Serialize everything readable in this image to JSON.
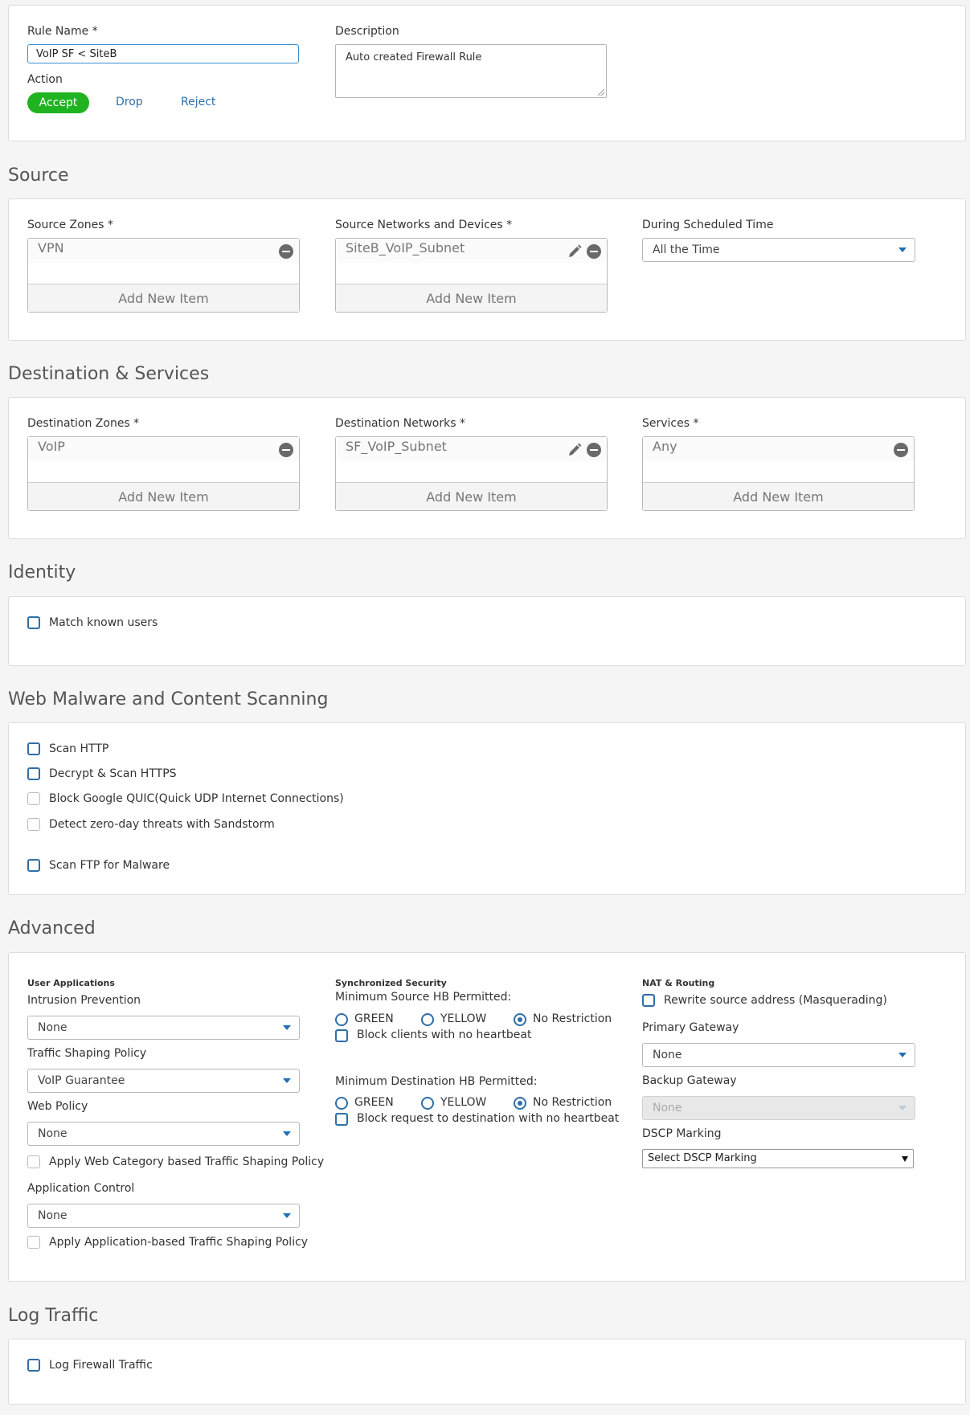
{
  "rule": {
    "name_label": "Rule Name *",
    "name_value": "VoIP SF < SiteB",
    "description_label": "Description",
    "description_value": "Auto created Firewall Rule",
    "action_label": "Action",
    "actions": [
      "Accept",
      "Drop",
      "Reject"
    ],
    "selected_action": "Accept"
  },
  "source": {
    "heading": "Source",
    "zones_label": "Source Zones *",
    "zones_item": "VPN",
    "networks_label": "Source Networks and Devices *",
    "networks_item": "SiteB_VoIP_Subnet",
    "schedule_label": "During Scheduled Time",
    "schedule_value": "All the Time",
    "add_new": "Add New Item"
  },
  "destination": {
    "heading": "Destination & Services",
    "zones_label": "Destination Zones *",
    "zones_item": "VoIP",
    "networks_label": "Destination Networks *",
    "networks_item": "SF_VoIP_Subnet",
    "services_label": "Services *",
    "services_item": "Any",
    "add_new": "Add New Item"
  },
  "identity": {
    "heading": "Identity",
    "match_known_users": "Match known users"
  },
  "web_scanning": {
    "heading": "Web Malware and Content Scanning",
    "scan_http": "Scan HTTP",
    "decrypt_https": "Decrypt & Scan HTTPS",
    "block_quic": "Block Google QUIC(Quick UDP Internet Connections)",
    "sandstorm": "Detect zero-day threats with Sandstorm",
    "scan_ftp": "Scan FTP for Malware"
  },
  "advanced": {
    "heading": "Advanced",
    "user_apps_title": "User Applications",
    "ips_label": "Intrusion Prevention",
    "ips_value": "None",
    "traffic_shaping_label": "Traffic Shaping Policy",
    "traffic_shaping_value": "VoIP Guarantee",
    "web_policy_label": "Web Policy",
    "web_policy_value": "None",
    "web_category_shaping": "Apply Web Category based Traffic Shaping Policy",
    "app_control_label": "Application Control",
    "app_control_value": "None",
    "app_shaping": "Apply Application-based Traffic Shaping Policy",
    "sync_title": "Synchronized Security",
    "min_source_hb": "Minimum Source HB Permitted:",
    "min_dest_hb": "Minimum Destination HB Permitted:",
    "hb_green": "GREEN",
    "hb_yellow": "YELLOW",
    "hb_none": "No Restriction",
    "block_clients": "Block clients with no heartbeat",
    "block_request": "Block request to destination with no heartbeat",
    "nat_title": "NAT & Routing",
    "masquerading": "Rewrite source address (Masquerading)",
    "primary_gw_label": "Primary Gateway",
    "primary_gw_value": "None",
    "backup_gw_label": "Backup Gateway",
    "backup_gw_value": "None",
    "dscp_label": "DSCP Marking",
    "dscp_value": "Select DSCP Marking"
  },
  "log": {
    "heading": "Log Traffic",
    "log_firewall": "Log Firewall Traffic"
  },
  "colors": {
    "accent": "#2f6fa8",
    "accept_green": "#1fb31f"
  }
}
